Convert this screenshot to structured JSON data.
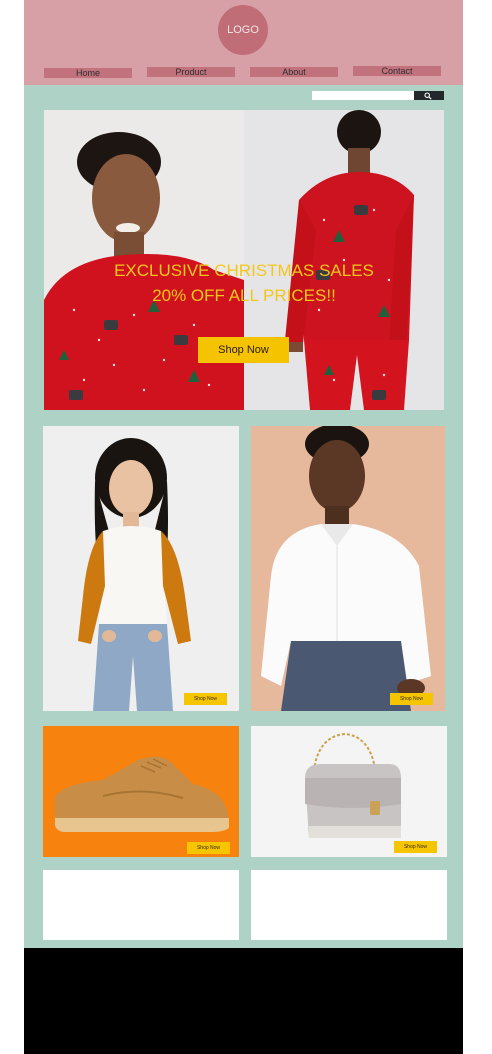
{
  "header": {
    "logo_text": "LOGO",
    "nav": [
      "Home",
      "Product",
      "About",
      "Contact"
    ]
  },
  "search": {
    "placeholder": "",
    "button_icon": "search-icon"
  },
  "hero": {
    "title_line1": "EXCLUSIVE CHRISTMAS SALES",
    "title_line2": "20% OFF ALL PRICES!!",
    "cta_label": "Shop Now"
  },
  "products": [
    {
      "cta_label": "Shop Now"
    },
    {
      "cta_label": "Shop Now"
    },
    {
      "cta_label": "Shop Now"
    },
    {
      "cta_label": "Shop Now"
    }
  ],
  "colors": {
    "background": "#aed3c6",
    "header": "#d7a0a7",
    "logo": "#c16d77",
    "nav_button": "#c1727d",
    "accent": "#f5c300",
    "footer": "#000000"
  }
}
